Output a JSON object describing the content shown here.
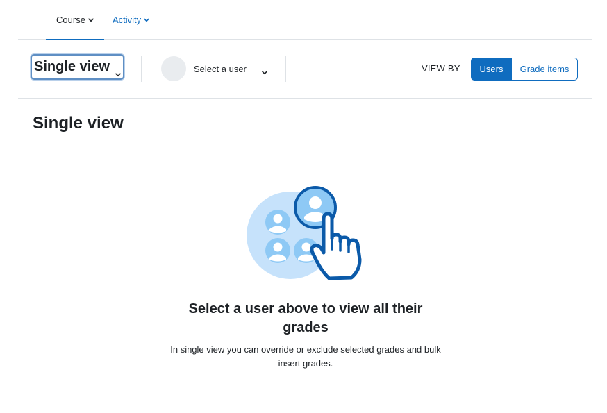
{
  "nav": {
    "tabs": [
      {
        "label": "Course",
        "active": true
      },
      {
        "label": "Activity",
        "active": false
      }
    ]
  },
  "toolbar": {
    "report_selector": {
      "label": "Single view"
    },
    "user_selector": {
      "label": "Select a user"
    },
    "view_by": {
      "label": "VIEW BY",
      "options": [
        {
          "label": "Users",
          "selected": true
        },
        {
          "label": "Grade items",
          "selected": false
        }
      ]
    }
  },
  "page": {
    "title": "Single view"
  },
  "empty_state": {
    "illustration_icon": "select-user-pointer-icon",
    "heading": "Select a user above to view all their grades",
    "description": "In single view you can override or exclude selected grades and bulk insert grades."
  },
  "colors": {
    "primary": "#0f6cbf",
    "text": "#1d2125",
    "border": "#dee2e6",
    "avatar_bg": "#e9ecef",
    "illustration_light": "#c6e2fb",
    "illustration_mid": "#8ec9f5",
    "illustration_dark": "#0b5aa9"
  }
}
